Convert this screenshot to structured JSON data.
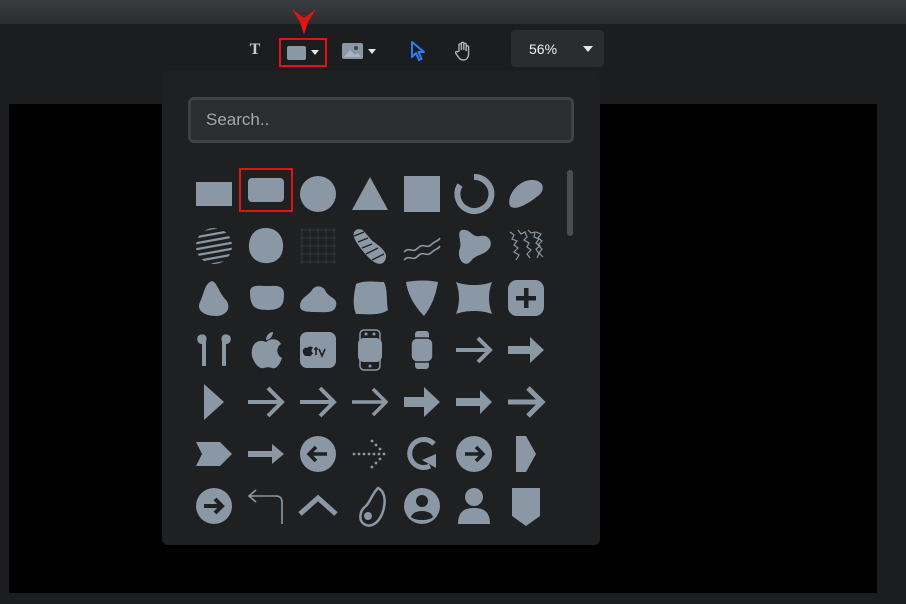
{
  "toolbar": {
    "text_tool_label": "T",
    "zoom_value": "56%",
    "tools": [
      "text-tool",
      "shape-tool",
      "image-tool",
      "select-tool",
      "hand-tool"
    ],
    "accent_color": "#2f7cf6",
    "highlight_color": "#e11414"
  },
  "shape_panel": {
    "search_placeholder": "Search..",
    "search_value": "",
    "shape_color": "#8a98a6",
    "shapes": [
      "rectangle",
      "rounded-rectangle",
      "circle",
      "triangle",
      "square",
      "ring",
      "blob",
      "striped-circle",
      "scribble-circle",
      "grid-pattern",
      "striped-blob",
      "wave-lines",
      "splash",
      "noise-square",
      "blob-1",
      "blob-2",
      "blob-3",
      "blob-4",
      "blob-5",
      "blob-6",
      "plus-button",
      "airpods",
      "apple-logo",
      "apple-tv",
      "watch-band",
      "apple-watch",
      "arrow-right-1",
      "arrow-right-2",
      "triangle-right",
      "arrow-right-3",
      "arrow-right-4",
      "arrow-right-5",
      "arrow-right-6",
      "arrow-right-7",
      "arrow-right-8",
      "arrow-flag",
      "arrow-short",
      "arrow-left-circle",
      "dotted-arrow",
      "rotate-arrow",
      "arrow-right-circle",
      "chevron-triangle",
      "arrow-right-circle-2",
      "return-arrow",
      "chevron-up",
      "beats-headphone",
      "user-circle",
      "user",
      "shield"
    ]
  }
}
